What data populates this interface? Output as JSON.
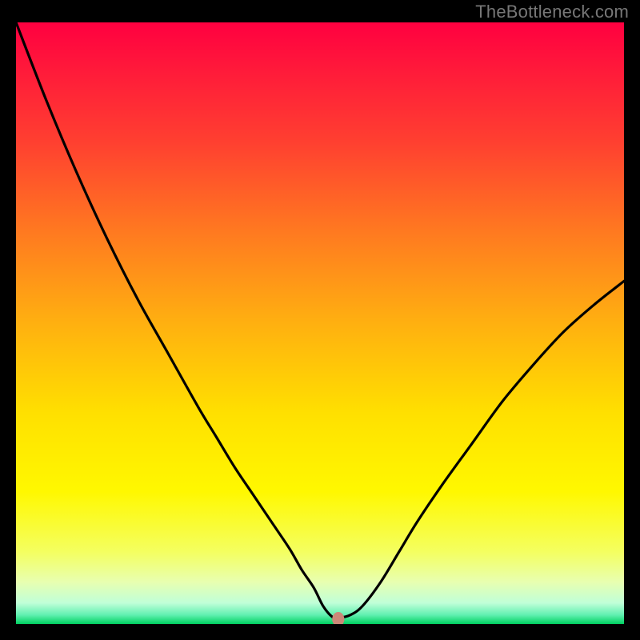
{
  "watermark": "TheBottleneck.com",
  "chart_data": {
    "type": "line",
    "title": "",
    "xlabel": "",
    "ylabel": "",
    "xlim": [
      0,
      100
    ],
    "ylim": [
      0,
      100
    ],
    "grid": false,
    "legend": false,
    "series": [
      {
        "name": "curve",
        "x": [
          0,
          5,
          10,
          15,
          20,
          25,
          30,
          33,
          36,
          39,
          42,
          45,
          47,
          49,
          50.5,
          52,
          53,
          55,
          57,
          60,
          63,
          66,
          70,
          75,
          80,
          85,
          90,
          95,
          100
        ],
        "y": [
          100,
          87,
          75,
          64,
          54,
          45,
          36,
          31,
          26,
          21.5,
          17,
          12.5,
          9,
          6,
          3,
          1.2,
          1,
          1.5,
          3,
          7,
          12,
          17,
          23,
          30,
          37,
          43,
          48.5,
          53,
          57
        ]
      }
    ],
    "marker": {
      "x": 53,
      "y": 0.8,
      "rx": 1.0,
      "ry": 1.2,
      "color": "#cb8878"
    },
    "gradient_stops": [
      {
        "offset": 0.0,
        "color": "#ff0040"
      },
      {
        "offset": 0.08,
        "color": "#ff1a3a"
      },
      {
        "offset": 0.2,
        "color": "#ff4030"
      },
      {
        "offset": 0.35,
        "color": "#ff7a20"
      },
      {
        "offset": 0.5,
        "color": "#ffb010"
      },
      {
        "offset": 0.65,
        "color": "#ffe000"
      },
      {
        "offset": 0.78,
        "color": "#fff800"
      },
      {
        "offset": 0.88,
        "color": "#f4ff60"
      },
      {
        "offset": 0.93,
        "color": "#e8ffb0"
      },
      {
        "offset": 0.965,
        "color": "#c0ffd8"
      },
      {
        "offset": 0.985,
        "color": "#60f0b0"
      },
      {
        "offset": 1.0,
        "color": "#00d060"
      }
    ]
  }
}
